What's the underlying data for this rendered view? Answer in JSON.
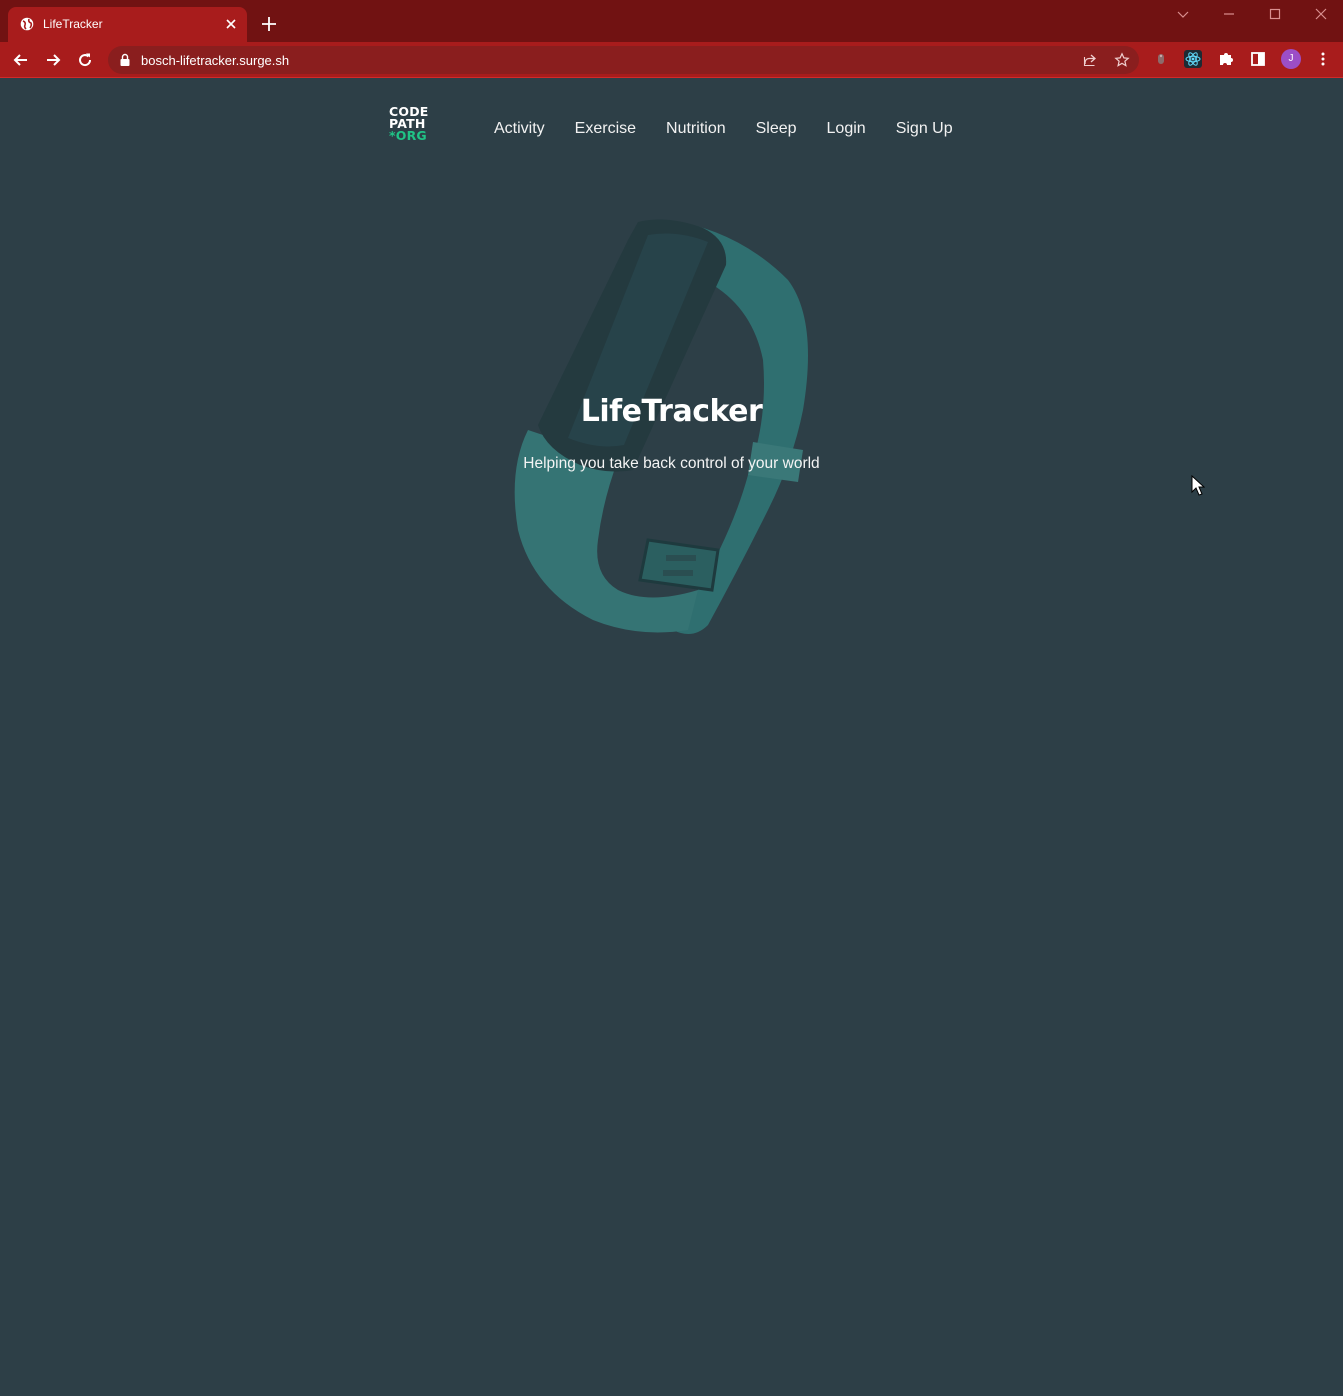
{
  "browser": {
    "tab_title": "LifeTracker",
    "url": "bosch-lifetracker.surge.sh",
    "profile_initial": "J",
    "colors": {
      "titlebar": "#711212",
      "toolbar": "#a81c1c",
      "omnibox": "#8a1e1e"
    }
  },
  "navbar": {
    "logo": {
      "line1": "CODE",
      "line2": "PATH",
      "line3": "*ORG"
    },
    "links": [
      "Activity",
      "Exercise",
      "Nutrition",
      "Sleep",
      "Login",
      "Sign Up"
    ]
  },
  "hero": {
    "title": "LifeTracker",
    "subtitle": "Helping you take back control of your world",
    "image": "fitness-band-image"
  },
  "colors": {
    "page_background": "#2d3f47",
    "logo_accent": "#20c486",
    "band": "#2d6f70"
  }
}
